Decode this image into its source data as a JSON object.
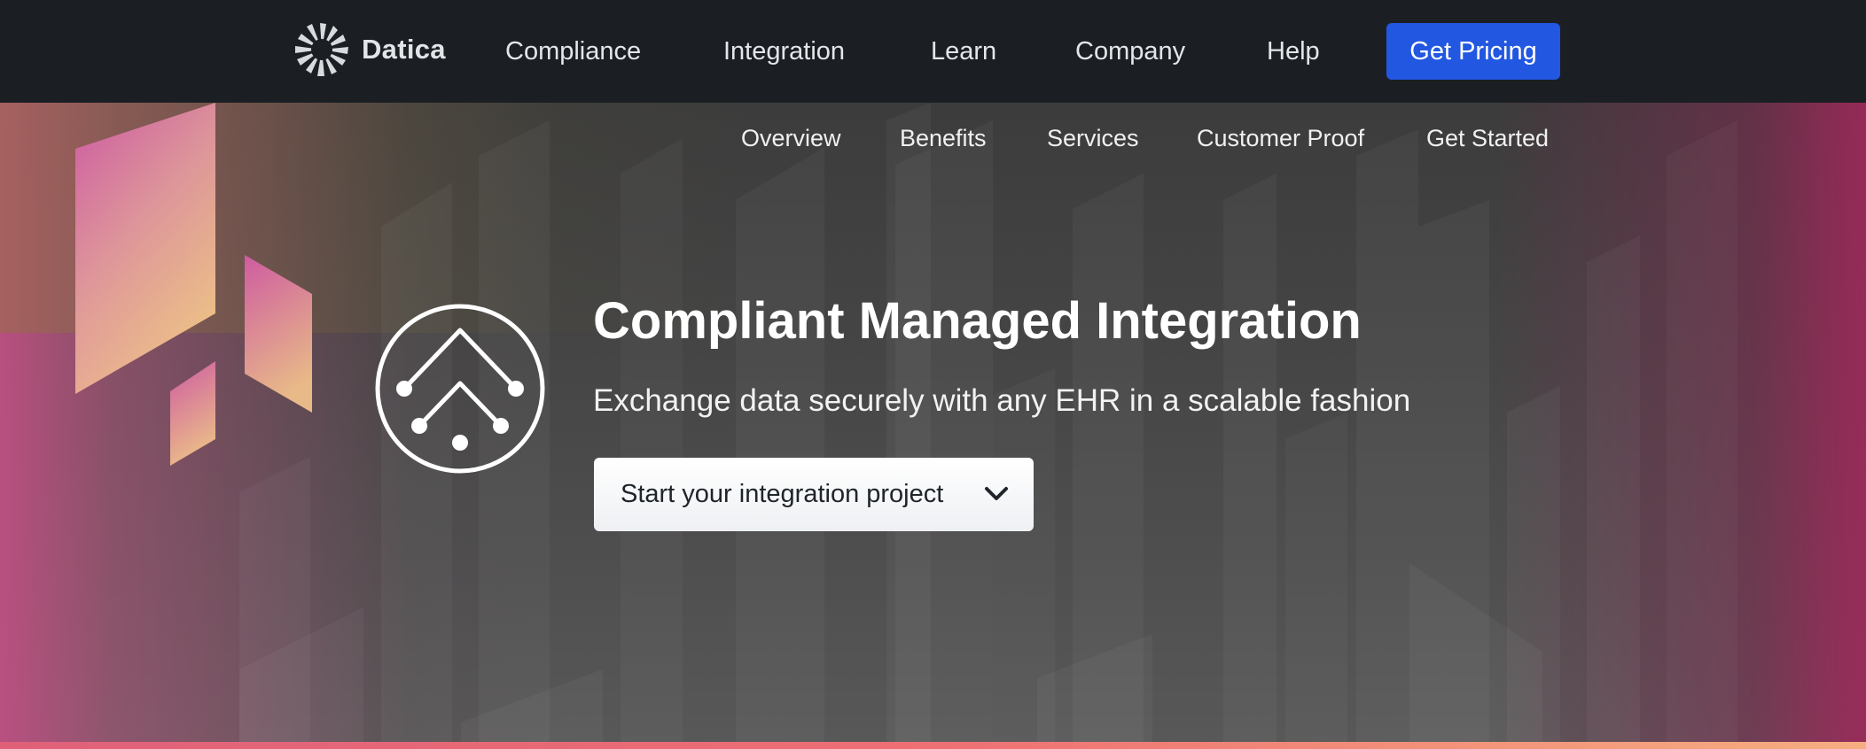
{
  "brand": {
    "name": "Datica"
  },
  "nav": {
    "items": [
      {
        "label": "Compliance"
      },
      {
        "label": "Integration"
      },
      {
        "label": "Learn"
      },
      {
        "label": "Company"
      },
      {
        "label": "Help"
      }
    ],
    "cta_label": "Get Pricing"
  },
  "subnav": {
    "items": [
      {
        "label": "Overview"
      },
      {
        "label": "Benefits"
      },
      {
        "label": "Services"
      },
      {
        "label": "Customer Proof"
      },
      {
        "label": "Get Started"
      }
    ]
  },
  "hero": {
    "title": "Compliant Managed Integration",
    "subtitle": "Exchange data securely with any EHR in a scalable fashion",
    "dropdown_label": "Start your integration project",
    "icon": "integration-tree-icon"
  },
  "colors": {
    "topbar": "#1b1f23",
    "accent": "#2257e1",
    "hero_gradient_pink": "#e05a9c",
    "hero_gradient_peach": "#f4c98e"
  }
}
